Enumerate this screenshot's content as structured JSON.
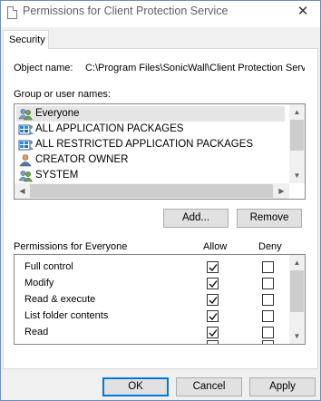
{
  "window": {
    "title": "Permissions for Client Protection Service",
    "close_glyph": "✕"
  },
  "tabs": [
    {
      "label": "Security",
      "active": true
    }
  ],
  "object": {
    "label": "Object name:",
    "value": "C:\\Program Files\\SonicWall\\Client Protection Servi"
  },
  "groups": {
    "label": "Group or user names:",
    "items": [
      {
        "name": "Everyone",
        "icon": "users-group-icon",
        "selected": true
      },
      {
        "name": "ALL APPLICATION PACKAGES",
        "icon": "package-group-icon",
        "selected": false
      },
      {
        "name": "ALL RESTRICTED APPLICATION PACKAGES",
        "icon": "package-group-icon",
        "selected": false
      },
      {
        "name": "CREATOR OWNER",
        "icon": "user-icon",
        "selected": false
      },
      {
        "name": "SYSTEM",
        "icon": "users-group-icon",
        "selected": false
      }
    ]
  },
  "actions": {
    "add": "Add...",
    "remove": "Remove"
  },
  "permissions": {
    "title": "Permissions for Everyone",
    "allow_header": "Allow",
    "deny_header": "Deny",
    "rows": [
      {
        "name": "Full control",
        "allow": true,
        "deny": false
      },
      {
        "name": "Modify",
        "allow": true,
        "deny": false
      },
      {
        "name": "Read & execute",
        "allow": true,
        "deny": false
      },
      {
        "name": "List folder contents",
        "allow": true,
        "deny": false
      },
      {
        "name": "Read",
        "allow": true,
        "deny": false
      }
    ]
  },
  "footer": {
    "ok": "OK",
    "cancel": "Cancel",
    "apply": "Apply"
  },
  "colors": {
    "accent": "#0078d7",
    "selection": "#e5e5e5",
    "face": "#f0f0f0"
  }
}
